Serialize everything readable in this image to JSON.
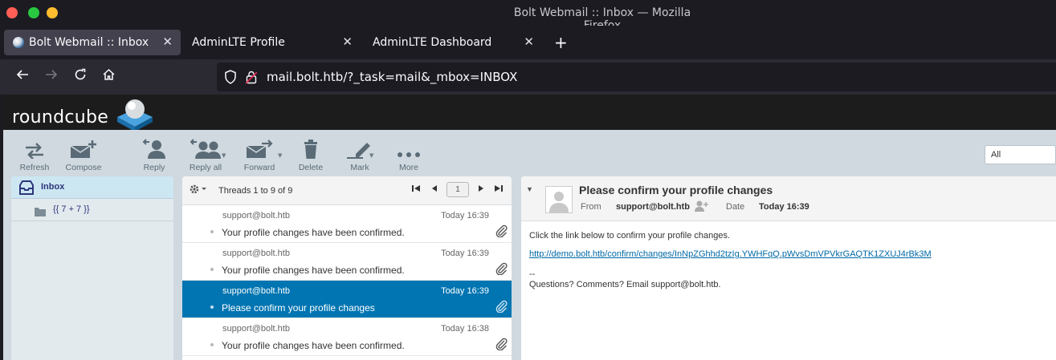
{
  "window": {
    "title": "Bolt Webmail :: Inbox — Mozilla Firefox"
  },
  "tabs": [
    {
      "label": "Bolt Webmail :: Inbox",
      "active": true
    },
    {
      "label": "AdminLTE Profile",
      "active": false
    },
    {
      "label": "AdminLTE Dashboard",
      "active": false
    }
  ],
  "newtab_label": "+",
  "close_glyph": "✕",
  "address": {
    "url": "mail.bolt.htb/?_task=mail&_mbox=INBOX"
  },
  "logo": {
    "text": "roundcube"
  },
  "toolbar": {
    "refresh": "Refresh",
    "compose": "Compose",
    "reply": "Reply",
    "reply_all": "Reply all",
    "forward": "Forward",
    "delete": "Delete",
    "mark": "Mark",
    "more": "More"
  },
  "search_filter": {
    "selected": "All"
  },
  "folders": [
    {
      "name": "Inbox",
      "selected": true
    },
    {
      "name": "{{ 7 + 7 }}",
      "selected": false
    }
  ],
  "message_list": {
    "count_label": "Threads 1 to 9 of 9",
    "page": "1",
    "messages": [
      {
        "from": "support@bolt.htb",
        "date": "Today 16:39",
        "subject": "Your profile changes have been confirmed.",
        "selected": false
      },
      {
        "from": "support@bolt.htb",
        "date": "Today 16:39",
        "subject": "Your profile changes have been confirmed.",
        "selected": false
      },
      {
        "from": "support@bolt.htb",
        "date": "Today 16:39",
        "subject": "Please confirm your profile changes",
        "selected": true
      },
      {
        "from": "support@bolt.htb",
        "date": "Today 16:38",
        "subject": "Your profile changes have been confirmed.",
        "selected": false
      }
    ]
  },
  "preview": {
    "subject": "Please confirm your profile changes",
    "from_label": "From",
    "from_value": "support@bolt.htb",
    "date_label": "Date",
    "date_value": "Today 16:39",
    "body_line1": "Click the link below to confirm your profile changes.",
    "link": "http://demo.bolt.htb/confirm/changes/InNpZGhhd2tzIg.YWHFqQ.pWvsDmVPVkrGAQTK1ZXUJ4rBk3M",
    "signature_sep": "--",
    "signature": "Questions? Comments? Email support@bolt.htb."
  },
  "colors": {
    "selected_row": "#0075b2",
    "folder_text": "#2c367b",
    "link": "#0069a6",
    "toolbar_bg": "#d0d9df"
  }
}
